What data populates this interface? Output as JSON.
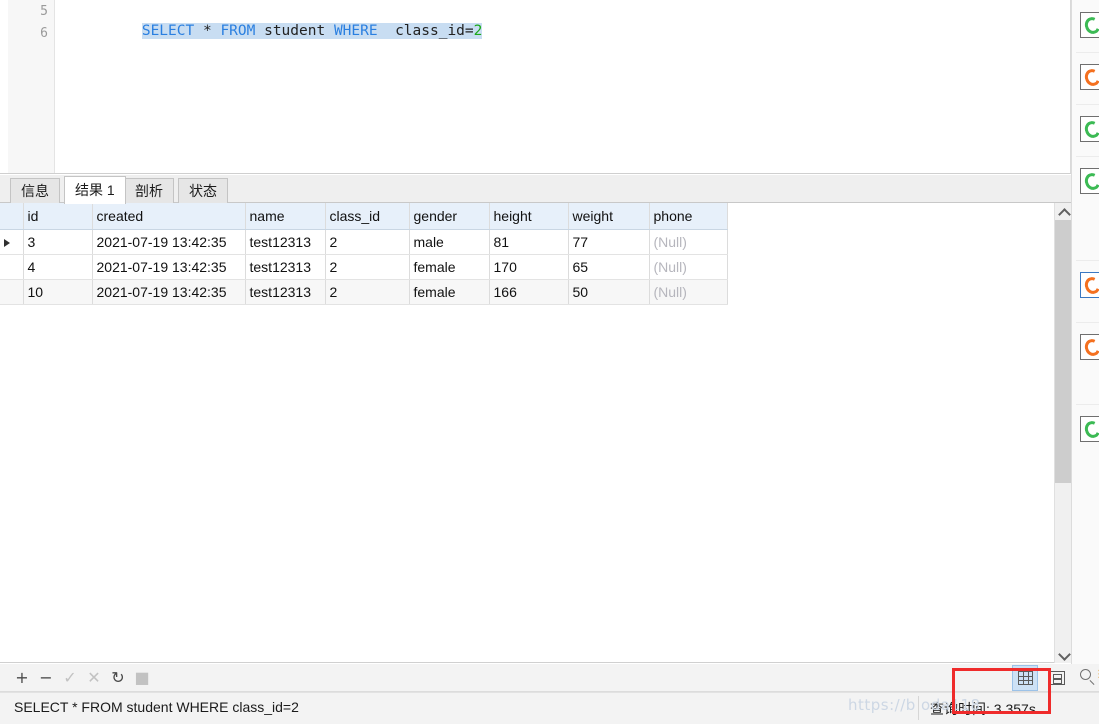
{
  "editor": {
    "line_numbers": [
      "5",
      "6"
    ],
    "sql_tokens": [
      {
        "t": "SELECT",
        "k": "kw"
      },
      {
        "t": " ",
        "k": "op"
      },
      {
        "t": "*",
        "k": "op"
      },
      {
        "t": " ",
        "k": "op"
      },
      {
        "t": "FROM",
        "k": "kw"
      },
      {
        "t": " ",
        "k": "op"
      },
      {
        "t": "student",
        "k": "ident"
      },
      {
        "t": " ",
        "k": "op"
      },
      {
        "t": "WHERE",
        "k": "kw"
      },
      {
        "t": "  ",
        "k": "op"
      },
      {
        "t": "class_id",
        "k": "ident"
      },
      {
        "t": "=",
        "k": "op"
      },
      {
        "t": "2",
        "k": "num"
      }
    ],
    "sql_text": "SELECT * FROM student WHERE  class_id=2"
  },
  "result_tabs": [
    {
      "label": "信息",
      "active": false
    },
    {
      "label": "结果 1",
      "active": true
    },
    {
      "label": "剖析",
      "active": false
    },
    {
      "label": "状态",
      "active": false
    }
  ],
  "grid": {
    "columns": [
      "id",
      "created",
      "name",
      "class_id",
      "gender",
      "height",
      "weight",
      "phone"
    ],
    "rows": [
      {
        "id": "3",
        "created": "2021-07-19 13:42:35",
        "name": "test12313",
        "class_id": "2",
        "gender": "male",
        "height": "81",
        "weight": "77",
        "phone": "(Null)"
      },
      {
        "id": "4",
        "created": "2021-07-19 13:42:35",
        "name": "test12313",
        "class_id": "2",
        "gender": "female",
        "height": "170",
        "weight": "65",
        "phone": "(Null)"
      },
      {
        "id": "10",
        "created": "2021-07-19 13:42:35",
        "name": "test12313",
        "class_id": "2",
        "gender": "female",
        "height": "166",
        "weight": "50",
        "phone": "(Null)"
      }
    ],
    "null_display": "(Null)",
    "selected_row_index": 0
  },
  "record_toolbar": {
    "buttons": [
      {
        "name": "add-record-button",
        "glyph": "+",
        "enabled": true
      },
      {
        "name": "delete-record-button",
        "glyph": "−",
        "enabled": true
      },
      {
        "name": "apply-changes-button",
        "glyph": "✓",
        "enabled": false
      },
      {
        "name": "cancel-changes-button",
        "glyph": "✕",
        "enabled": false
      },
      {
        "name": "refresh-button",
        "glyph": "↻",
        "enabled": true
      },
      {
        "name": "stop-button",
        "glyph": "■",
        "enabled": false
      }
    ],
    "view_grid_label": "grid-view",
    "view_form_label": "form-view",
    "grid_view_selected": true
  },
  "statusbar": {
    "sql": "SELECT * FROM student WHERE  class_id=2",
    "query_time": "查询时间: 3.357s"
  },
  "watermark": {
    "text": "https://b            oda118"
  },
  "right_panel": {
    "items": [
      {
        "name": "panel-icon-1",
        "color": "green",
        "active": false
      },
      {
        "name": "panel-icon-2",
        "color": "orange",
        "active": false
      },
      {
        "name": "panel-icon-3",
        "color": "green",
        "active": false
      },
      {
        "name": "panel-icon-4",
        "color": "green",
        "active": false
      },
      {
        "name": "panel-icon-5",
        "color": "orange",
        "active": true
      },
      {
        "name": "panel-icon-6",
        "color": "orange",
        "active": false
      },
      {
        "name": "panel-icon-7",
        "color": "green",
        "active": false
      }
    ]
  },
  "colors": {
    "keyword": "#2a7fe0",
    "number": "#1aa81a",
    "selection": "#c8ddf2",
    "header_bg": "#e7f0fa",
    "annotation": "#ef2b2b",
    "null_text": "#b6b6bd"
  }
}
